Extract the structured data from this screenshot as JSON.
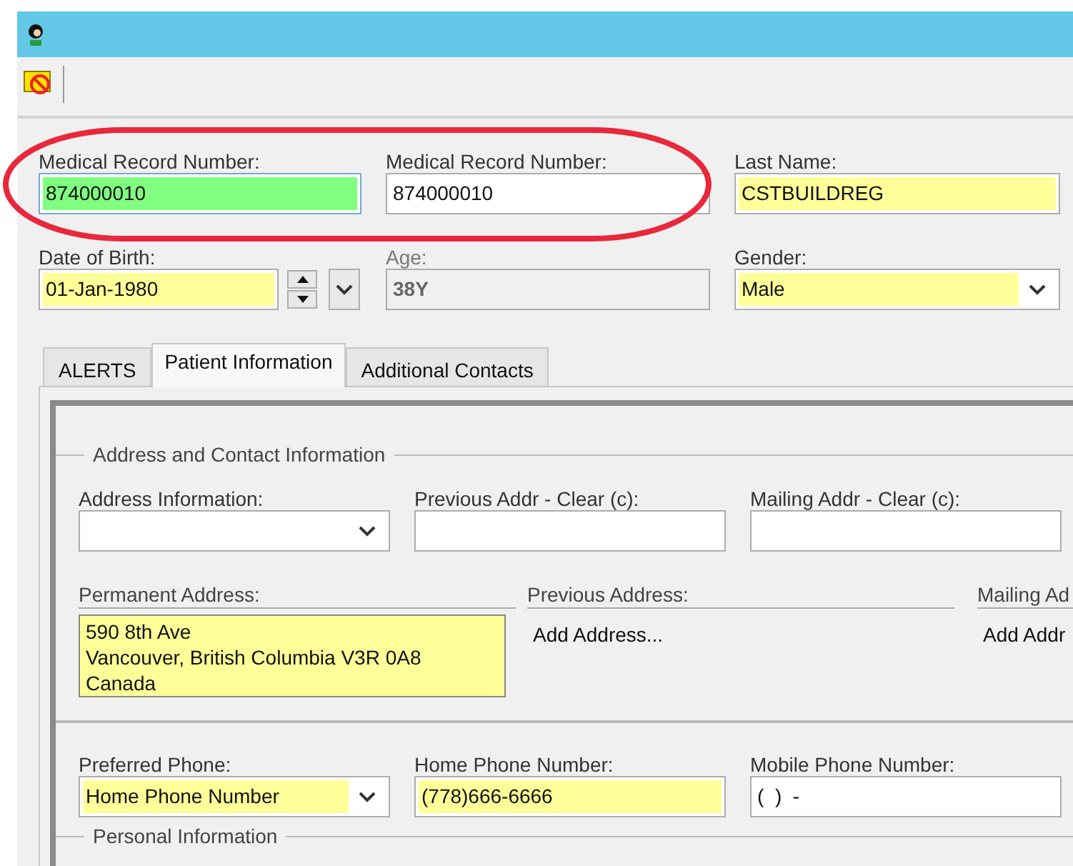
{
  "header_fields": [
    {
      "kind": "text",
      "label": "Medical Record Number:",
      "value": "874000010",
      "focused": true,
      "disabled": false
    },
    {
      "kind": "text",
      "label": "Medical Record Number:",
      "value": "874000010",
      "focused": false,
      "required": false,
      "disabled": false
    },
    {
      "kind": "text",
      "label": "Last Name:",
      "value": "CSTBUILDREG",
      "focused": false,
      "required": true,
      "disabled": false
    },
    {
      "kind": "date",
      "label": "Date of Birth:",
      "value": "01-Jan-1980",
      "focused": false,
      "required": true,
      "disabled": false
    },
    {
      "kind": "text",
      "label": "Age:",
      "value": "38Y",
      "focused": false,
      "required": false,
      "disabled": true
    },
    {
      "kind": "combo",
      "label": "Gender:",
      "value": "Male",
      "focused": false,
      "required": true,
      "disabled": false
    }
  ],
  "tabs": [
    {
      "label": "ALERTS",
      "selected": false
    },
    {
      "label": "Patient Information",
      "selected": true
    },
    {
      "label": "Additional Contacts",
      "selected": false
    }
  ],
  "address_group": {
    "title": "Address and Contact Information",
    "fields": [
      {
        "kind": "combo",
        "label": "Address Information:",
        "focused": false,
        "required": false,
        "disabled": false
      },
      {
        "kind": "text",
        "label": "Previous Addr - Clear (c):",
        "focused": false,
        "required": false,
        "disabled": false
      },
      {
        "kind": "text",
        "label": "Mailing Addr - Clear (c):",
        "focused": false,
        "required": false,
        "disabled": false
      }
    ],
    "addresses": [
      {
        "kind": "box",
        "label": "Permanent Address:",
        "lines": [
          "590 8th Ave",
          "Vancouver, British Columbia V3R 0A8",
          "Canada"
        ]
      },
      {
        "kind": "link",
        "label": "Previous Address:",
        "link": "Add Address..."
      },
      {
        "kind": "link",
        "label": "Mailing Ad",
        "link": "Add Addr"
      }
    ],
    "phone_fields": [
      {
        "kind": "combo",
        "label": "Preferred Phone:",
        "value": "Home Phone Number",
        "focused": false,
        "required": true,
        "disabled": false
      },
      {
        "kind": "text",
        "label": "Home Phone Number:",
        "value": "(778)666-6666",
        "focused": false,
        "required": true,
        "disabled": false
      },
      {
        "kind": "text",
        "label": "Mobile Phone Number:",
        "value": "(  )  -",
        "focused": false,
        "required": false,
        "disabled": false
      }
    ]
  },
  "personal_group": {
    "title": "Personal Information"
  }
}
